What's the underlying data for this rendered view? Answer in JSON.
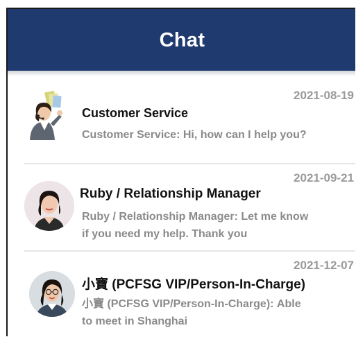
{
  "header": {
    "title": "Chat",
    "background_color": "#1e3a6e"
  },
  "chats": [
    {
      "avatar_icon": "customer-service-agent-icon",
      "name": "Customer Service",
      "date": "2021-08-19",
      "preview": "Customer Service: Hi, how can I help you?"
    },
    {
      "avatar_icon": "avatar-photo-ruby",
      "name": "Ruby / Relationship Manager",
      "date": "2021-09-21",
      "preview": "Ruby / Relationship Manager: Let me know if you need my help. Thank you"
    },
    {
      "avatar_icon": "avatar-photo-person-in-charge",
      "name": "小寶 (PCFSG VIP/Person-In-Charge)",
      "date": "2021-12-07",
      "preview": "小寶 (PCFSG VIP/Person-In-Charge): Able to meet in Shanghai"
    }
  ]
}
